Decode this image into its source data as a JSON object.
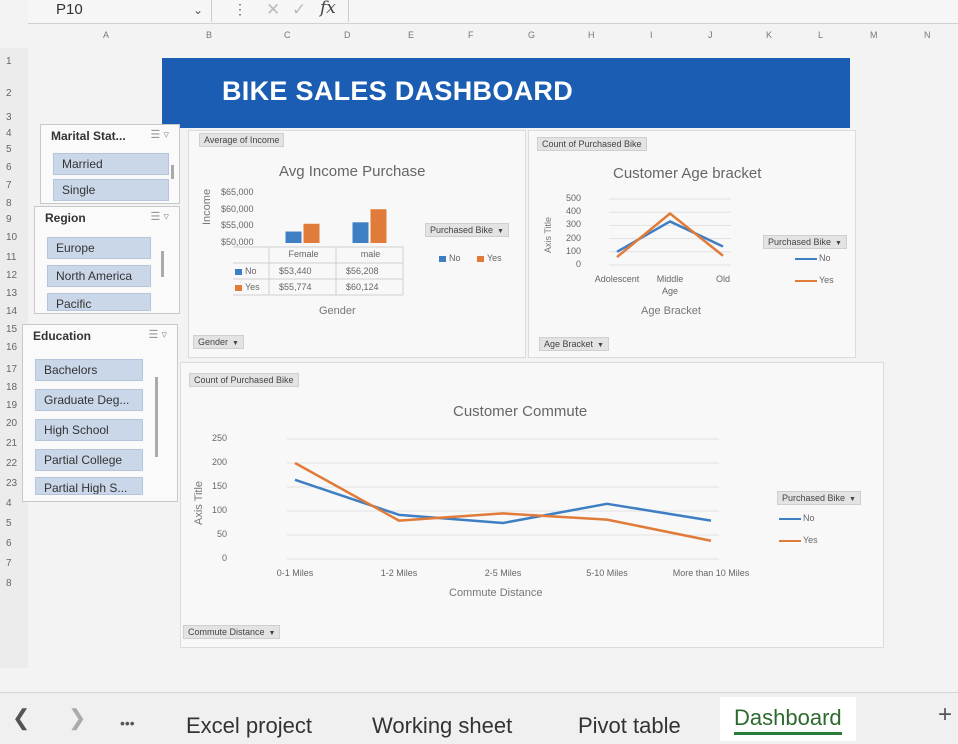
{
  "formula_bar": {
    "name_box": "P10",
    "fx": "fx",
    "formula": ""
  },
  "columns": [
    "A",
    "B",
    "C",
    "D",
    "E",
    "F",
    "G",
    "H",
    "I",
    "J",
    "K",
    "L",
    "M",
    "N"
  ],
  "rows": [
    "1",
    "2",
    "3",
    "4",
    "5",
    "6",
    "7",
    "8",
    "9",
    "10",
    "11",
    "12",
    "13",
    "14",
    "15",
    "16",
    "17",
    "18",
    "19",
    "20",
    "21",
    "22",
    "23",
    "4",
    "5",
    "6",
    "7",
    "8"
  ],
  "banner": {
    "title": "BIKE SALES DASHBOARD"
  },
  "slicers": {
    "marital": {
      "title": "Marital Stat...",
      "items": [
        "Married",
        "Single"
      ]
    },
    "region": {
      "title": "Region",
      "items": [
        "Europe",
        "North America",
        "Pacific"
      ]
    },
    "education": {
      "title": "Education",
      "items": [
        "Bachelors",
        "Graduate Deg...",
        "High School",
        "Partial College",
        "Partial High S..."
      ]
    }
  },
  "charts": {
    "income": {
      "field_top": "Average of Income",
      "field_bottom": "Gender",
      "field_legend": "Purchased Bike"
    },
    "age": {
      "field_top": "Count of Purchased Bike",
      "field_bottom": "Age Bracket",
      "field_legend": "Purchased Bike"
    },
    "commute": {
      "field_top": "Count of Purchased Bike",
      "field_bottom": "Commute Distance",
      "field_legend": "Purchased Bike"
    }
  },
  "chart_data": [
    {
      "type": "bar",
      "title": "Avg Income Purchase",
      "xlabel": "Gender",
      "ylabel": "Income",
      "categories": [
        "Female",
        "male"
      ],
      "yticks": [
        "$65,000",
        "$60,000",
        "$55,000",
        "$50,000"
      ],
      "ylim": [
        50000,
        65000
      ],
      "series": [
        {
          "name": "No",
          "values": [
            53440,
            56208
          ],
          "labels": [
            "$53,440",
            "$56,208"
          ],
          "color": "#3e7fc4"
        },
        {
          "name": "Yes",
          "values": [
            55774,
            60124
          ],
          "labels": [
            "$55,774",
            "$60,124"
          ],
          "color": "#e07b39"
        }
      ],
      "legend": "right"
    },
    {
      "type": "line",
      "title": "Customer Age bracket",
      "xlabel": "Age Bracket",
      "ylabel": "Axis Title",
      "categories": [
        "Adolescent",
        "Middle Age",
        "Old"
      ],
      "category_labels": [
        "Adolescent",
        "Middle\nAge",
        "Old"
      ],
      "yticks": [
        "500",
        "400",
        "300",
        "200",
        "100",
        "0"
      ],
      "ylim": [
        0,
        500
      ],
      "series": [
        {
          "name": "No",
          "values": [
            100,
            330,
            140
          ],
          "color": "#3e7fc4"
        },
        {
          "name": "Yes",
          "values": [
            60,
            390,
            70
          ],
          "color": "#e07b39"
        }
      ],
      "legend": "right"
    },
    {
      "type": "line",
      "title": "Customer Commute",
      "xlabel": "Commute Distance",
      "ylabel": "Axis Title",
      "categories": [
        "0-1 Miles",
        "1-2 Miles",
        "2-5 Miles",
        "5-10 Miles",
        "More than 10 Miles"
      ],
      "yticks": [
        "250",
        "200",
        "150",
        "100",
        "50",
        "0"
      ],
      "ylim": [
        0,
        250
      ],
      "series": [
        {
          "name": "No",
          "values": [
            165,
            92,
            75,
            115,
            80
          ],
          "color": "#3e7fc4"
        },
        {
          "name": "Yes",
          "values": [
            200,
            80,
            95,
            82,
            38
          ],
          "color": "#e07b39"
        }
      ],
      "legend": "right"
    }
  ],
  "sheet_tabs": {
    "tabs": [
      "Excel project",
      "Working sheet",
      "Pivot table",
      "Dashboard"
    ],
    "active": "Dashboard",
    "more": "•••",
    "add": "+"
  },
  "colors": {
    "banner": "#1a5db3",
    "series_no": "#3e7fc4",
    "series_yes": "#e07b39",
    "slicer_item": "#c9d7e8"
  },
  "icons": [
    "chevron-left-icon",
    "chevron-right-icon",
    "more-icon",
    "add-sheet-icon",
    "multi-select-icon",
    "clear-filter-icon",
    "dropdown-icon"
  ]
}
